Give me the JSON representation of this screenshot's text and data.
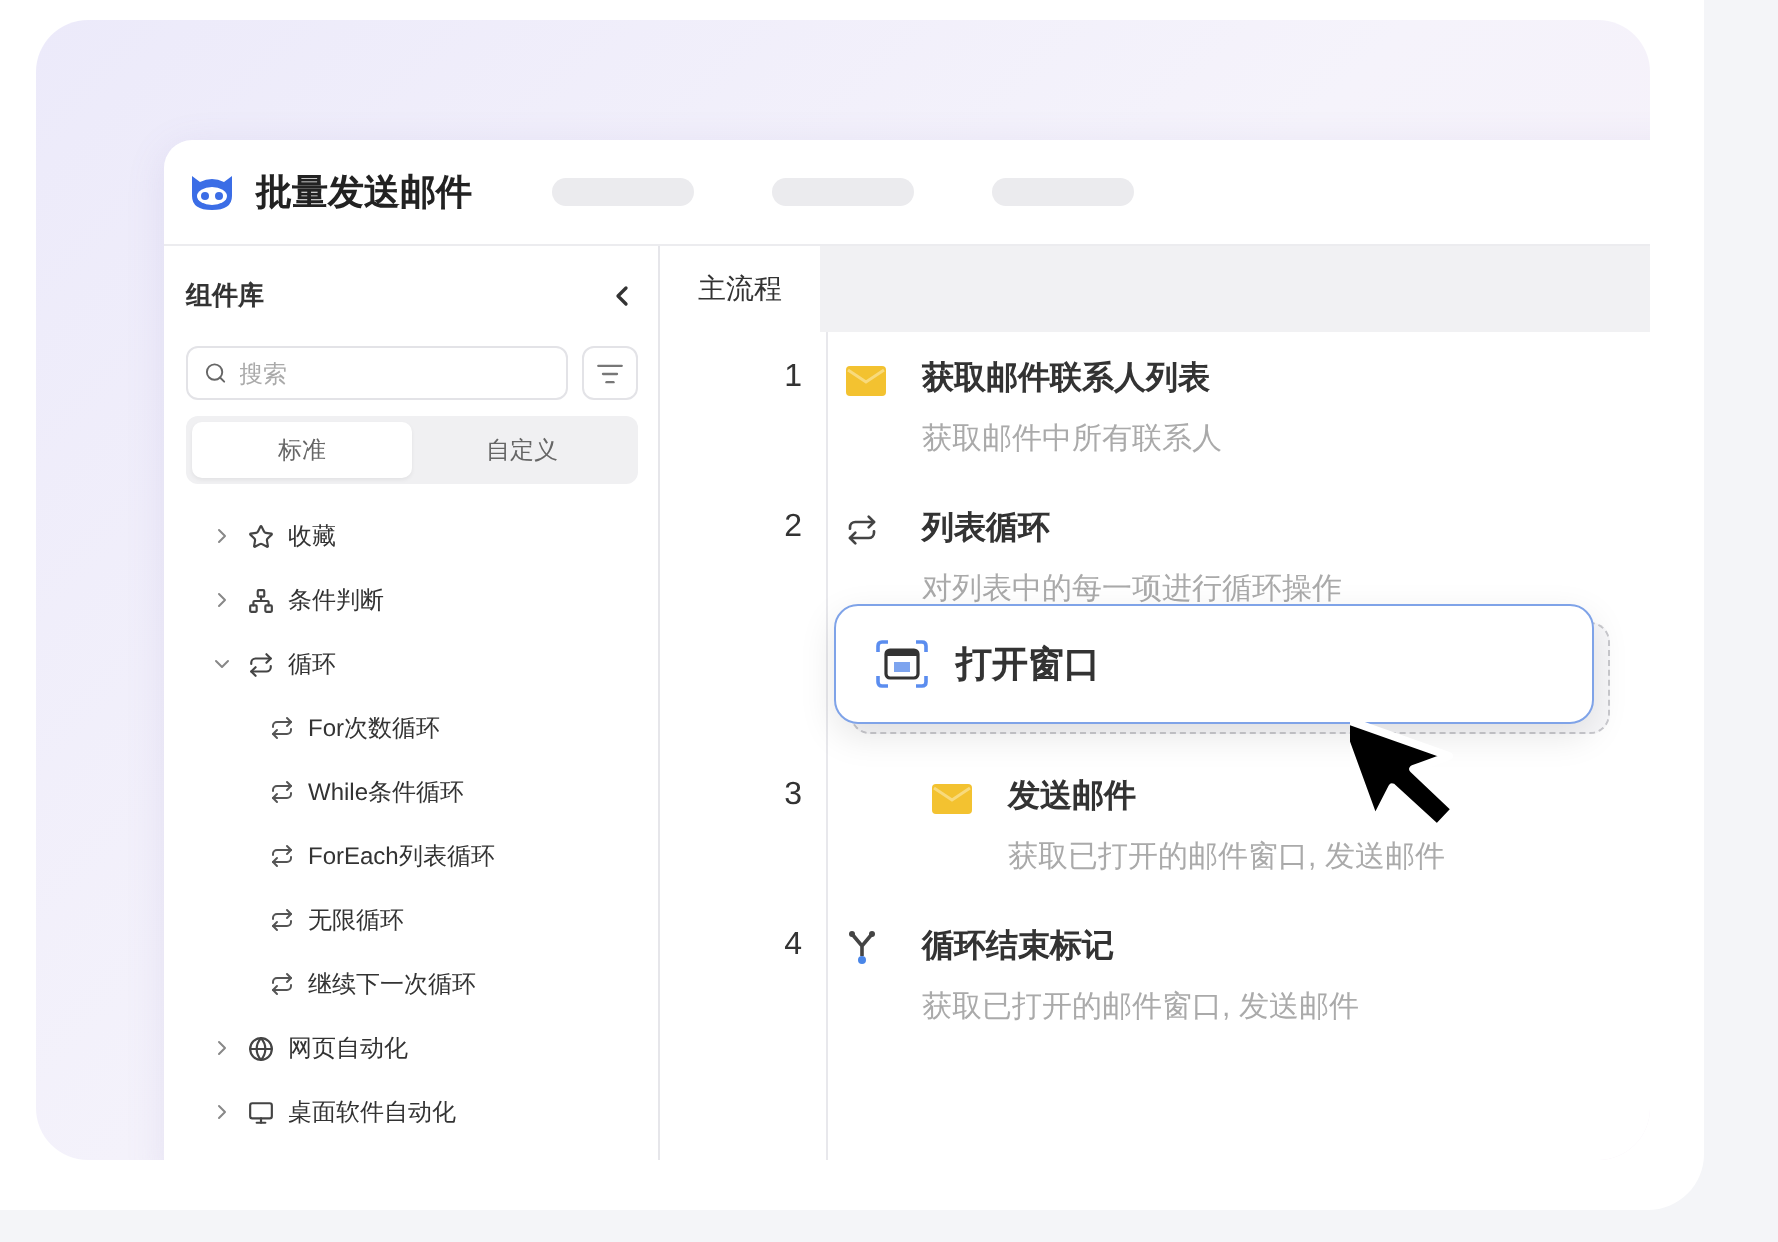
{
  "window": {
    "title": "批量发送邮件"
  },
  "sidebar": {
    "title": "组件库",
    "search": {
      "placeholder": "搜索"
    },
    "tabs": [
      {
        "label": "标准",
        "selected": true
      },
      {
        "label": "自定义",
        "selected": false
      }
    ],
    "items": [
      {
        "label": "收藏",
        "expanded": false
      },
      {
        "label": "条件判断",
        "expanded": false
      },
      {
        "label": "循环",
        "expanded": true,
        "children": [
          {
            "label": "For次数循环"
          },
          {
            "label": "While条件循环"
          },
          {
            "label": "ForEach列表循环"
          },
          {
            "label": "无限循环"
          },
          {
            "label": "继续下一次循环"
          }
        ]
      },
      {
        "label": "网页自动化",
        "expanded": false
      },
      {
        "label": "桌面软件自动化",
        "expanded": false
      }
    ]
  },
  "main": {
    "tabs": [
      {
        "label": "主流程",
        "selected": true
      }
    ],
    "steps": [
      {
        "number": "1",
        "kind": "mail",
        "title": "获取邮件联系人列表",
        "description": "获取邮件中所有联系人"
      },
      {
        "number": "2",
        "kind": "loop",
        "title": "列表循环",
        "description": "对列表中的每一项进行循环操作",
        "children": [
          {
            "number": "3",
            "kind": "mail",
            "title": "发送邮件",
            "description": "获取已打开的邮件窗口, 发送邮件"
          }
        ]
      },
      {
        "number": "4",
        "kind": "loop-end",
        "title": "循环结束标记",
        "description": "获取已打开的邮件窗口, 发送邮件"
      }
    ],
    "dragged": {
      "title": "打开窗口"
    }
  }
}
